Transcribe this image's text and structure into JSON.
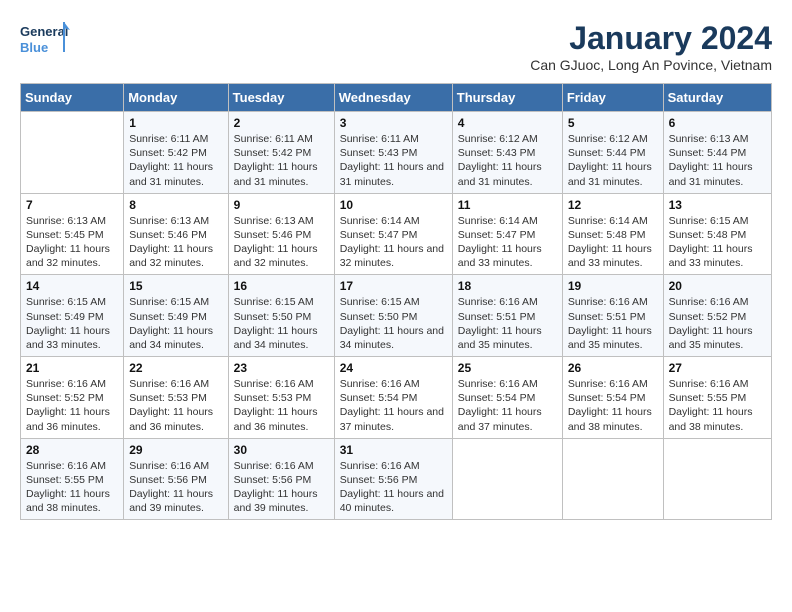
{
  "header": {
    "logo_general": "General",
    "logo_blue": "Blue",
    "month_title": "January 2024",
    "location": "Can GJuoc, Long An Povince, Vietnam"
  },
  "columns": [
    "Sunday",
    "Monday",
    "Tuesday",
    "Wednesday",
    "Thursday",
    "Friday",
    "Saturday"
  ],
  "weeks": [
    [
      {
        "day": "",
        "sunrise": "",
        "sunset": "",
        "daylight": ""
      },
      {
        "day": "1",
        "sunrise": "Sunrise: 6:11 AM",
        "sunset": "Sunset: 5:42 PM",
        "daylight": "Daylight: 11 hours and 31 minutes."
      },
      {
        "day": "2",
        "sunrise": "Sunrise: 6:11 AM",
        "sunset": "Sunset: 5:42 PM",
        "daylight": "Daylight: 11 hours and 31 minutes."
      },
      {
        "day": "3",
        "sunrise": "Sunrise: 6:11 AM",
        "sunset": "Sunset: 5:43 PM",
        "daylight": "Daylight: 11 hours and 31 minutes."
      },
      {
        "day": "4",
        "sunrise": "Sunrise: 6:12 AM",
        "sunset": "Sunset: 5:43 PM",
        "daylight": "Daylight: 11 hours and 31 minutes."
      },
      {
        "day": "5",
        "sunrise": "Sunrise: 6:12 AM",
        "sunset": "Sunset: 5:44 PM",
        "daylight": "Daylight: 11 hours and 31 minutes."
      },
      {
        "day": "6",
        "sunrise": "Sunrise: 6:13 AM",
        "sunset": "Sunset: 5:44 PM",
        "daylight": "Daylight: 11 hours and 31 minutes."
      }
    ],
    [
      {
        "day": "7",
        "sunrise": "Sunrise: 6:13 AM",
        "sunset": "Sunset: 5:45 PM",
        "daylight": "Daylight: 11 hours and 32 minutes."
      },
      {
        "day": "8",
        "sunrise": "Sunrise: 6:13 AM",
        "sunset": "Sunset: 5:46 PM",
        "daylight": "Daylight: 11 hours and 32 minutes."
      },
      {
        "day": "9",
        "sunrise": "Sunrise: 6:13 AM",
        "sunset": "Sunset: 5:46 PM",
        "daylight": "Daylight: 11 hours and 32 minutes."
      },
      {
        "day": "10",
        "sunrise": "Sunrise: 6:14 AM",
        "sunset": "Sunset: 5:47 PM",
        "daylight": "Daylight: 11 hours and 32 minutes."
      },
      {
        "day": "11",
        "sunrise": "Sunrise: 6:14 AM",
        "sunset": "Sunset: 5:47 PM",
        "daylight": "Daylight: 11 hours and 33 minutes."
      },
      {
        "day": "12",
        "sunrise": "Sunrise: 6:14 AM",
        "sunset": "Sunset: 5:48 PM",
        "daylight": "Daylight: 11 hours and 33 minutes."
      },
      {
        "day": "13",
        "sunrise": "Sunrise: 6:15 AM",
        "sunset": "Sunset: 5:48 PM",
        "daylight": "Daylight: 11 hours and 33 minutes."
      }
    ],
    [
      {
        "day": "14",
        "sunrise": "Sunrise: 6:15 AM",
        "sunset": "Sunset: 5:49 PM",
        "daylight": "Daylight: 11 hours and 33 minutes."
      },
      {
        "day": "15",
        "sunrise": "Sunrise: 6:15 AM",
        "sunset": "Sunset: 5:49 PM",
        "daylight": "Daylight: 11 hours and 34 minutes."
      },
      {
        "day": "16",
        "sunrise": "Sunrise: 6:15 AM",
        "sunset": "Sunset: 5:50 PM",
        "daylight": "Daylight: 11 hours and 34 minutes."
      },
      {
        "day": "17",
        "sunrise": "Sunrise: 6:15 AM",
        "sunset": "Sunset: 5:50 PM",
        "daylight": "Daylight: 11 hours and 34 minutes."
      },
      {
        "day": "18",
        "sunrise": "Sunrise: 6:16 AM",
        "sunset": "Sunset: 5:51 PM",
        "daylight": "Daylight: 11 hours and 35 minutes."
      },
      {
        "day": "19",
        "sunrise": "Sunrise: 6:16 AM",
        "sunset": "Sunset: 5:51 PM",
        "daylight": "Daylight: 11 hours and 35 minutes."
      },
      {
        "day": "20",
        "sunrise": "Sunrise: 6:16 AM",
        "sunset": "Sunset: 5:52 PM",
        "daylight": "Daylight: 11 hours and 35 minutes."
      }
    ],
    [
      {
        "day": "21",
        "sunrise": "Sunrise: 6:16 AM",
        "sunset": "Sunset: 5:52 PM",
        "daylight": "Daylight: 11 hours and 36 minutes."
      },
      {
        "day": "22",
        "sunrise": "Sunrise: 6:16 AM",
        "sunset": "Sunset: 5:53 PM",
        "daylight": "Daylight: 11 hours and 36 minutes."
      },
      {
        "day": "23",
        "sunrise": "Sunrise: 6:16 AM",
        "sunset": "Sunset: 5:53 PM",
        "daylight": "Daylight: 11 hours and 36 minutes."
      },
      {
        "day": "24",
        "sunrise": "Sunrise: 6:16 AM",
        "sunset": "Sunset: 5:54 PM",
        "daylight": "Daylight: 11 hours and 37 minutes."
      },
      {
        "day": "25",
        "sunrise": "Sunrise: 6:16 AM",
        "sunset": "Sunset: 5:54 PM",
        "daylight": "Daylight: 11 hours and 37 minutes."
      },
      {
        "day": "26",
        "sunrise": "Sunrise: 6:16 AM",
        "sunset": "Sunset: 5:54 PM",
        "daylight": "Daylight: 11 hours and 38 minutes."
      },
      {
        "day": "27",
        "sunrise": "Sunrise: 6:16 AM",
        "sunset": "Sunset: 5:55 PM",
        "daylight": "Daylight: 11 hours and 38 minutes."
      }
    ],
    [
      {
        "day": "28",
        "sunrise": "Sunrise: 6:16 AM",
        "sunset": "Sunset: 5:55 PM",
        "daylight": "Daylight: 11 hours and 38 minutes."
      },
      {
        "day": "29",
        "sunrise": "Sunrise: 6:16 AM",
        "sunset": "Sunset: 5:56 PM",
        "daylight": "Daylight: 11 hours and 39 minutes."
      },
      {
        "day": "30",
        "sunrise": "Sunrise: 6:16 AM",
        "sunset": "Sunset: 5:56 PM",
        "daylight": "Daylight: 11 hours and 39 minutes."
      },
      {
        "day": "31",
        "sunrise": "Sunrise: 6:16 AM",
        "sunset": "Sunset: 5:56 PM",
        "daylight": "Daylight: 11 hours and 40 minutes."
      },
      {
        "day": "",
        "sunrise": "",
        "sunset": "",
        "daylight": ""
      },
      {
        "day": "",
        "sunrise": "",
        "sunset": "",
        "daylight": ""
      },
      {
        "day": "",
        "sunrise": "",
        "sunset": "",
        "daylight": ""
      }
    ]
  ]
}
